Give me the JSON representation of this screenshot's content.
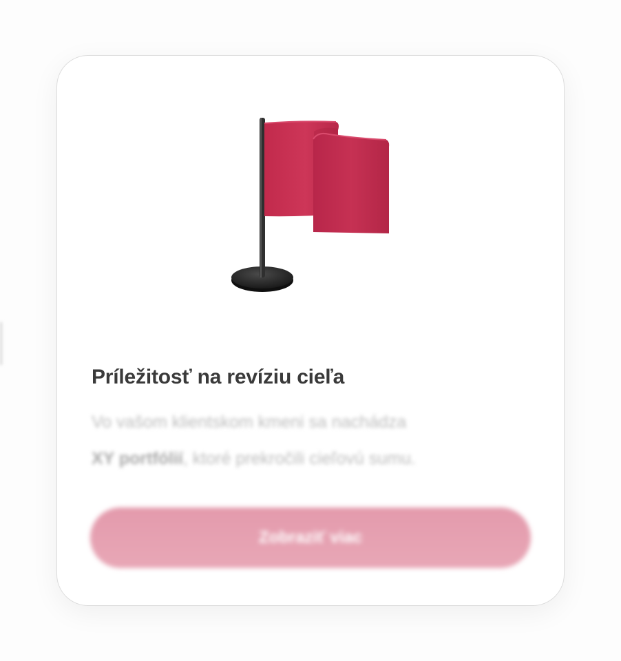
{
  "card": {
    "illustration_icon": "red-flag-icon",
    "title": "Príležitosť na revíziu cieľa",
    "description_line1": "Vo vašom klientskom kmeni sa nachádza",
    "description_strong": "XY portfólií",
    "description_rest": ", ktoré prekročili cieľovú sumu.",
    "button_label": "Zobraziť viac"
  },
  "colors": {
    "flag": "#c42d50",
    "button": "#e39aac",
    "title_text": "#3a3a3a",
    "description_text": "#bdbdbd"
  }
}
